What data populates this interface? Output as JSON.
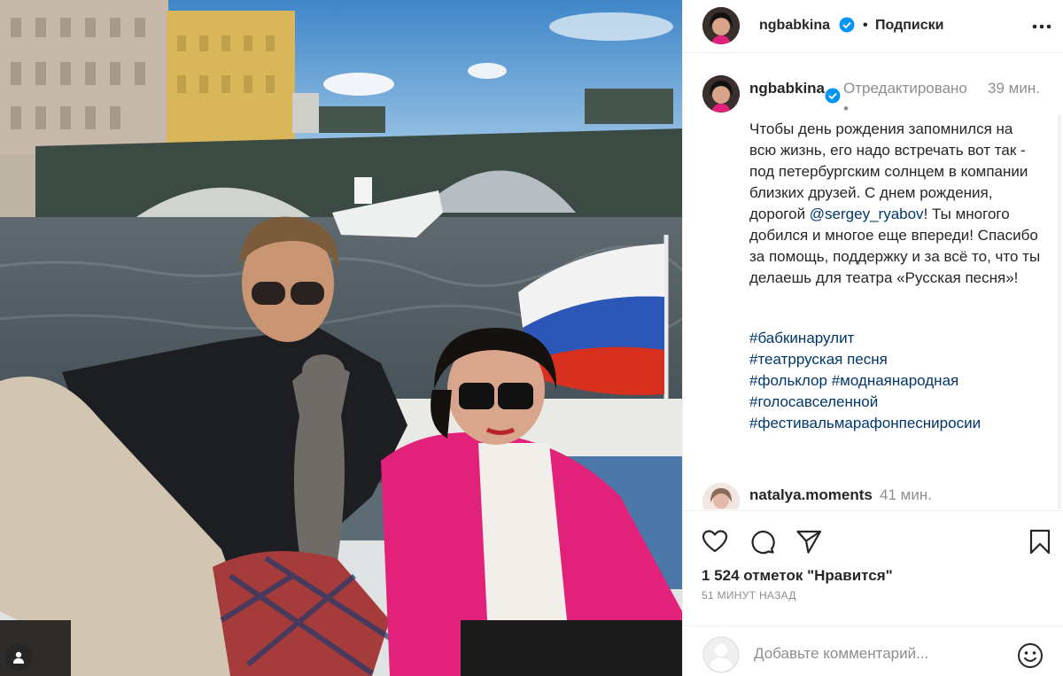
{
  "post": {
    "username": "ngbabkina",
    "follow_dot": "•",
    "follow_label": "Подписки",
    "more_icon": "more-horizontal-icon",
    "verified_color": "#0095f6"
  },
  "caption": {
    "username": "ngbabkina",
    "edited": "Отредактировано",
    "dot": "•",
    "time": "39 мин.",
    "text_before": "Чтобы день рождения запомнился на всю жизнь, его надо встречать вот так - под петербургским солнцем в компании близких друзей. С днем рождения, дорогой ",
    "mention": "@sergey_ryabov",
    "text_after": "! Ты многого добился и многое еще впереди! Спасибо за помощь, поддержку и за всё то, что ты делаешь для театра «Русская песня»!",
    "hashtags": [
      "#бабкинарулит",
      "#театрруская песня",
      "#фольклор",
      "#моднаянародная",
      "#голосавселенной",
      "#фестивальмарафонпесниросии"
    ]
  },
  "comment": {
    "username": "natalya.moments",
    "time": "41 мин."
  },
  "actions": {
    "like_icon": "heart-icon",
    "comment_icon": "comment-icon",
    "share_icon": "share-icon",
    "save_icon": "bookmark-icon",
    "likes": "1 524 отметок \"Нравится\"",
    "posted_ago": "51 МИНУТ НАЗАД"
  },
  "comment_box": {
    "placeholder": "Добавьте комментарий...",
    "emoji_icon": "emoji-icon"
  },
  "colors": {
    "text": "#262626",
    "secondary": "#8e8e8e",
    "link": "#00376b",
    "border": "#efefef"
  }
}
